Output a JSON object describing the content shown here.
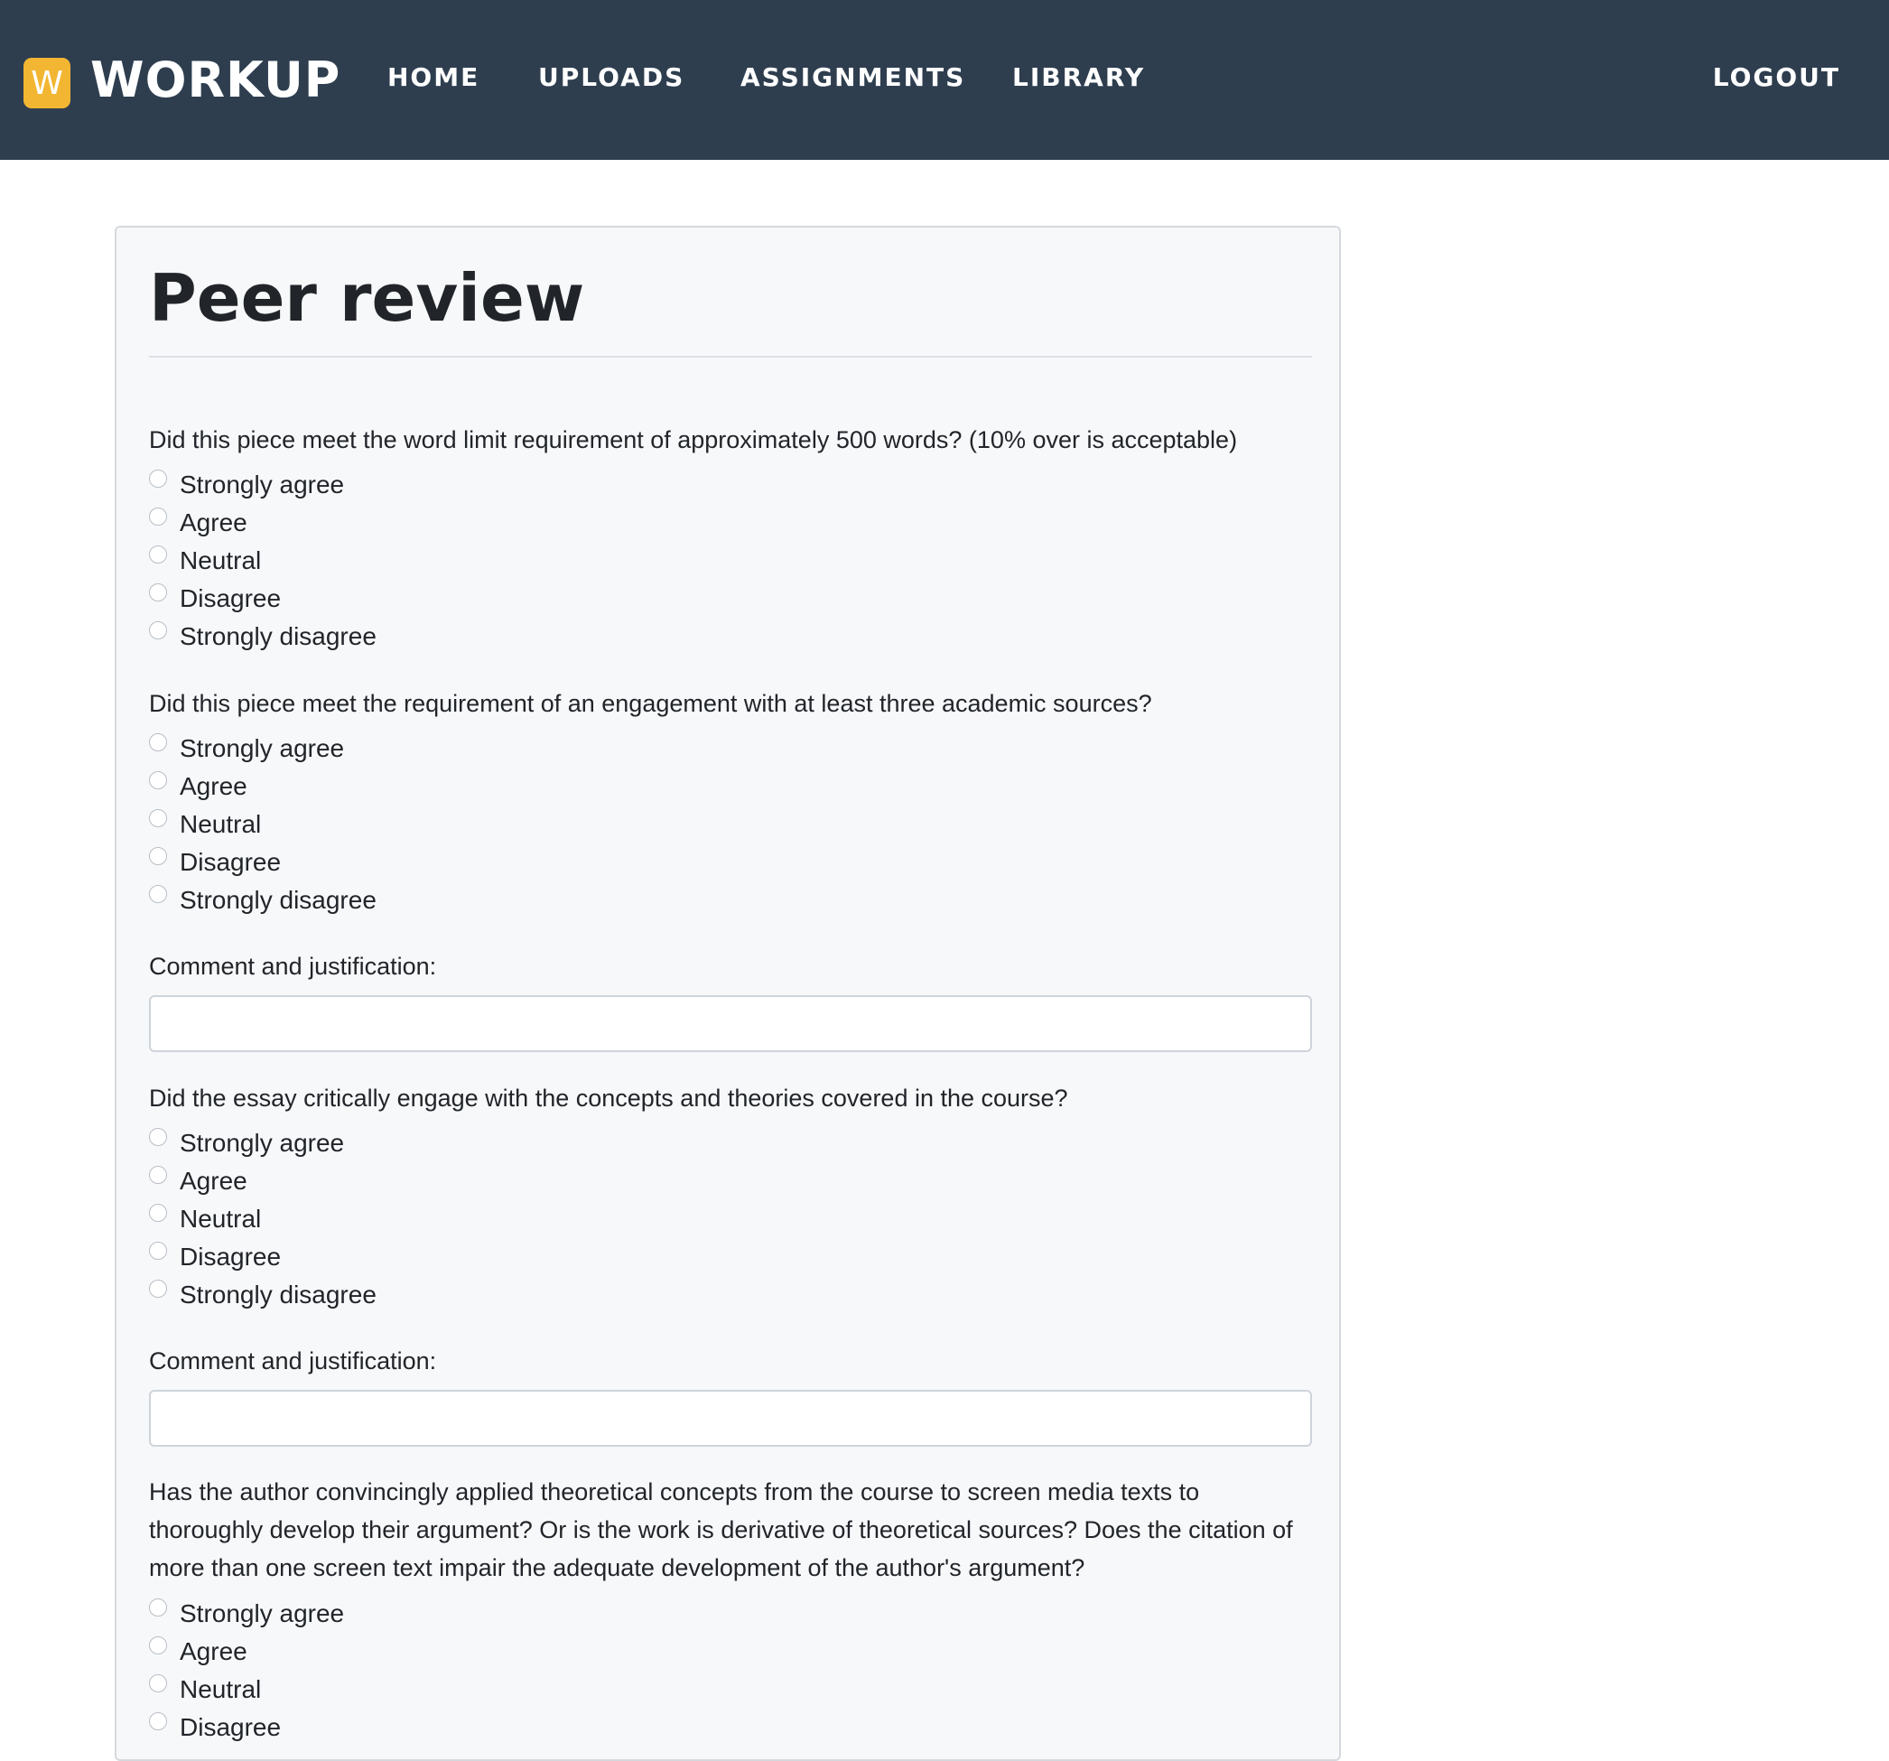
{
  "navbar": {
    "brand_letter": "W",
    "brand_name": "WORKUP",
    "links": {
      "home": "HOME",
      "uploads": "UPLOADS",
      "assignments": "ASSIGNMENTS",
      "library": "LIBRARY",
      "logout": "LOGOUT"
    },
    "colors": {
      "background": "#2e3e4f",
      "brand_accent": "#f2b632"
    }
  },
  "page": {
    "title": "Peer review"
  },
  "form": {
    "questions": [
      {
        "text": "Did this piece meet the word limit requirement of approximately 500 words? (10% over is acceptable)",
        "options": [
          "Strongly agree",
          "Agree",
          "Neutral",
          "Disagree",
          "Strongly disagree"
        ]
      },
      {
        "text": "Did this piece meet the requirement of an engagement with at least three academic sources?",
        "options": [
          "Strongly agree",
          "Agree",
          "Neutral",
          "Disagree",
          "Strongly disagree"
        ],
        "comment_label": "Comment and justification:",
        "comment_value": ""
      },
      {
        "text": "Did the essay critically engage with the concepts and theories covered in the course?",
        "options": [
          "Strongly agree",
          "Agree",
          "Neutral",
          "Disagree",
          "Strongly disagree"
        ],
        "comment_label": "Comment and justification:",
        "comment_value": ""
      },
      {
        "text": "Has the author convincingly applied theoretical concepts from the course to screen media texts to thoroughly develop their argument? Or is the work is derivative of theoretical sources? Does the citation of more than one screen text impair the adequate development of the author's argument?",
        "options": [
          "Strongly agree",
          "Agree",
          "Neutral",
          "Disagree"
        ]
      }
    ]
  }
}
